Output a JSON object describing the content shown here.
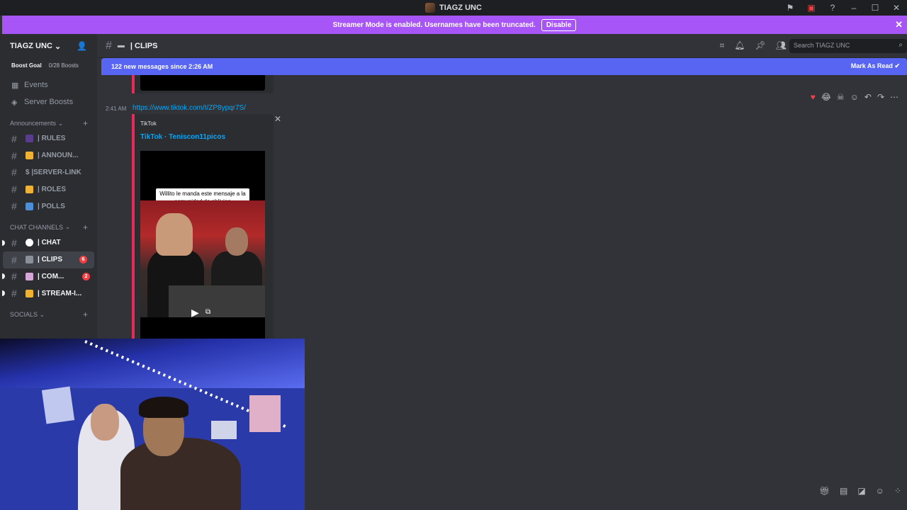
{
  "window": {
    "title": "TIAGZ UNC",
    "controls": [
      "minimize",
      "maximize",
      "close"
    ]
  },
  "notice": {
    "text": "Streamer Mode is enabled. Usernames have been truncated.",
    "button": "Disable"
  },
  "server": {
    "name": "TIAGZ UNC",
    "boost_label": "Boost Goal",
    "boost_count": "0/28 Boosts",
    "links": [
      {
        "label": "Events",
        "icon": "calendar-icon"
      },
      {
        "label": "Server Boosts",
        "icon": "boost-icon"
      }
    ],
    "categories": [
      {
        "name": "Announcements",
        "channels": [
          {
            "name": "| RULES",
            "color": "#5a3c8c"
          },
          {
            "name": "| ANNOUN...",
            "color": "#f0b232"
          },
          {
            "name": "$ |SERVER-LINK",
            "color": ""
          },
          {
            "name": "| ROLES",
            "color": "#f0b232"
          },
          {
            "name": "| POLLS",
            "color": "#4e8ed6"
          }
        ]
      },
      {
        "name": "CHAT CHANNELS",
        "channels": [
          {
            "name": "| CHAT",
            "color": "#ffffff",
            "unread": true
          },
          {
            "name": "| CLIPS",
            "color": "#8a8f98",
            "active": true,
            "badge": "6"
          },
          {
            "name": "| COM...",
            "color": "#d6a7d6",
            "unread": true,
            "badge": "2"
          },
          {
            "name": "| STREAM-I...",
            "color": "#f0b232",
            "unread": true
          }
        ]
      },
      {
        "name": "SOCIALS",
        "channels": []
      }
    ]
  },
  "channel": {
    "title": "| CLIPS",
    "search_placeholder": "Search TIAGZ UNC"
  },
  "newbar": {
    "text": "122 new messages since 2:26 AM",
    "action": "Mark As Read"
  },
  "message": {
    "time": "2:41 AM",
    "link": "https://www.tiktok.com/t/ZP8ypqr7S/",
    "embed": {
      "provider": "TikTok",
      "author": "TikTok · Teniscon11picos",
      "caption": "Willito le manda este mensaje a la comunidad de oblivion"
    }
  }
}
